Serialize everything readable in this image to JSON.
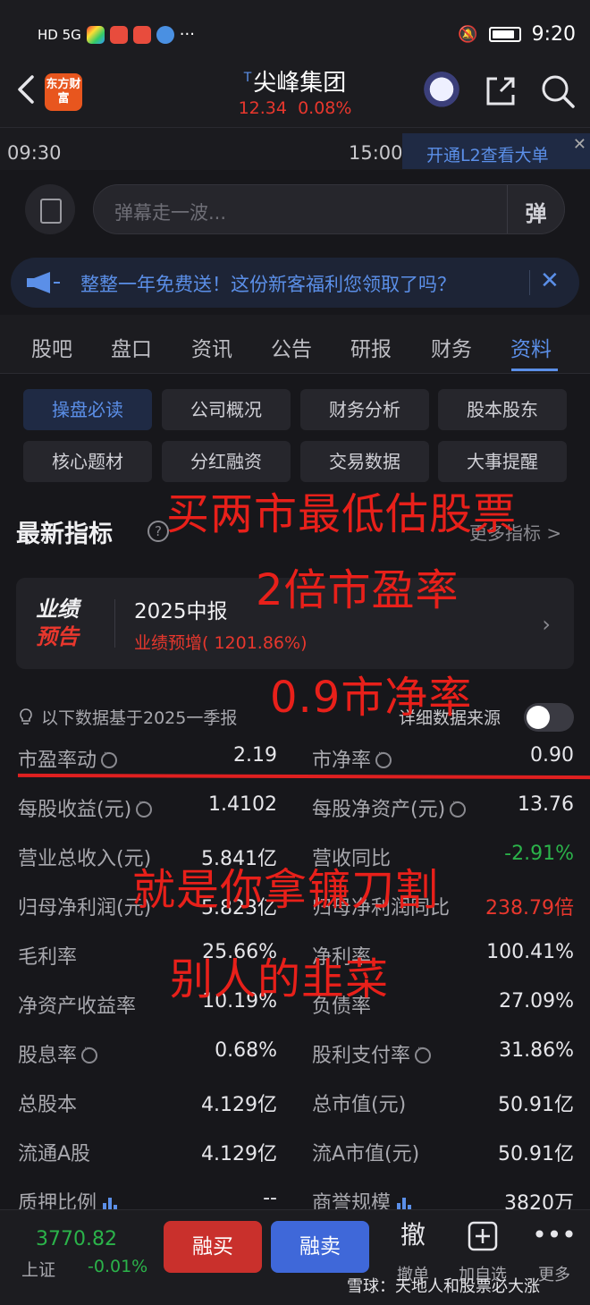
{
  "status_bar": {
    "network": "HD 5G",
    "time": "9:20"
  },
  "header": {
    "stock_name": "尖峰集团",
    "stock_prefix": "T",
    "price": "12.34",
    "change_pct": "0.08%",
    "logo_text": "东方财富"
  },
  "chart": {
    "time_start": "09:30",
    "time_end": "15:00",
    "l2_label": "开通L2查看大单"
  },
  "danmaku": {
    "placeholder": "弹幕走一波...",
    "send_label": "弹"
  },
  "banner": {
    "text": "整整一年免费送！这份新客福利您领取了吗？"
  },
  "tabs": [
    "股吧",
    "盘口",
    "资讯",
    "公告",
    "研报",
    "财务",
    "资料"
  ],
  "active_tab": "资料",
  "subnav": [
    [
      "操盘必读",
      "公司概况",
      "财务分析",
      "股本股东"
    ],
    [
      "核心题材",
      "分红融资",
      "交易数据",
      "大事提醒"
    ]
  ],
  "indicators": {
    "title": "最新指标",
    "more": "更多指标 >",
    "forecast": {
      "logo_top": "业绩",
      "logo_bottom": "预告",
      "title": "2025中报",
      "subtitle": "业绩预增( 1201.86%)"
    },
    "note": "以下数据基于2025一季报",
    "source_label": "详细数据来源",
    "rows": [
      {
        "l_label": "市盈率动",
        "l_value": "2.19",
        "r_label": "市净率",
        "r_value": "0.90"
      },
      {
        "l_label": "每股收益(元)",
        "l_value": "1.4102",
        "r_label": "每股净资产(元)",
        "r_value": "13.76"
      },
      {
        "l_label": "营业总收入(元)",
        "l_value": "5.841亿",
        "r_label": "营收同比",
        "r_value": "-2.91%"
      },
      {
        "l_label": "归母净利润(元)",
        "l_value": "5.823亿",
        "r_label": "归母净利润同比",
        "r_value": "238.79倍"
      },
      {
        "l_label": "毛利率",
        "l_value": "25.66%",
        "r_label": "净利率",
        "r_value": "100.41%"
      },
      {
        "l_label": "净资产收益率",
        "l_value": "10.19%",
        "r_label": "负债率",
        "r_value": "27.09%"
      },
      {
        "l_label": "股息率",
        "l_value": "0.68%",
        "r_label": "股利支付率",
        "r_value": "31.86%"
      },
      {
        "l_label": "总股本",
        "l_value": "4.129亿",
        "r_label": "总市值(元)",
        "r_value": "50.91亿"
      },
      {
        "l_label": "流通A股",
        "l_value": "4.129亿",
        "r_label": "流A市值(元)",
        "r_value": "50.91亿"
      },
      {
        "l_label": "质押比例",
        "l_value": "--",
        "r_label": "商誉规模",
        "r_value": "3820万"
      }
    ]
  },
  "annotations": [
    "买两市最低估股票",
    "2倍市盈率",
    "0.9市净率",
    "就是你拿镰刀割",
    "别人的韭菜"
  ],
  "bottom": {
    "index_value": "3770.82",
    "index_name": "上证",
    "index_change": "-0.01%",
    "buy_label": "融买",
    "sell_label": "融卖",
    "actions": [
      {
        "icon": "撤",
        "label": "撤单"
      },
      {
        "icon": "plus-box-icon",
        "label": "加自选"
      },
      {
        "icon": "more-dots-icon",
        "label": "更多"
      }
    ],
    "watermark": "雪球：天地人和股票必大涨"
  },
  "colors": {
    "accent": "#5b8fe8",
    "up": "#e8372d",
    "down": "#2bb34a",
    "annotation": "#e8201a"
  }
}
